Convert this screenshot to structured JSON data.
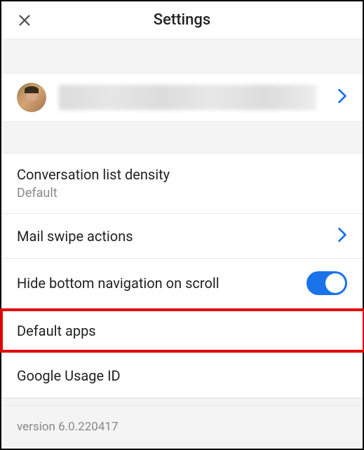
{
  "header": {
    "title": "Settings"
  },
  "account": {
    "name_redacted": true
  },
  "settings": {
    "density": {
      "label": "Conversation list density",
      "value": "Default"
    },
    "swipe": {
      "label": "Mail swipe actions"
    },
    "hideNav": {
      "label": "Hide bottom navigation on scroll",
      "enabled": true
    },
    "defaultApps": {
      "label": "Default apps"
    },
    "usageId": {
      "label": "Google Usage ID"
    }
  },
  "footer": {
    "version": "version 6.0.220417"
  }
}
